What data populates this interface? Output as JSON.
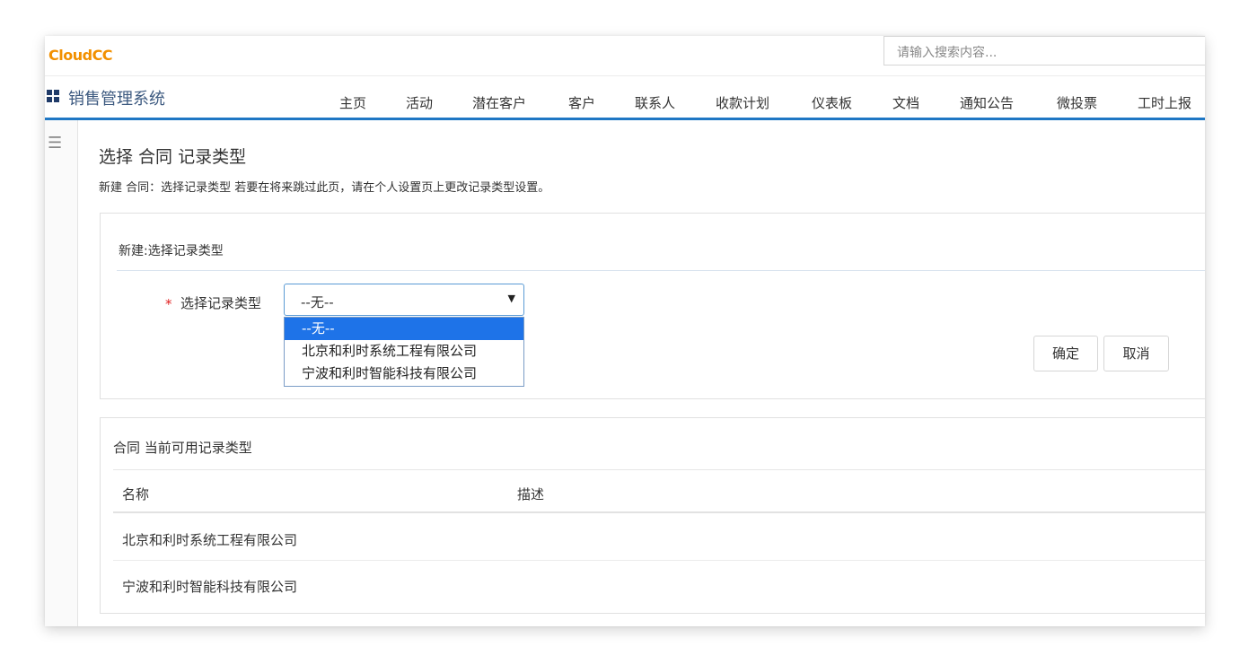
{
  "brand": {
    "logo": "CloudCC",
    "logo_color": "#f29000"
  },
  "search": {
    "placeholder": "请输入搜索内容..."
  },
  "app": {
    "title": "销售管理系统",
    "accent": "#1f77c4"
  },
  "nav": {
    "items": [
      "主页",
      "活动",
      "潜在客户",
      "客户",
      "联系人",
      "收款计划",
      "仪表板",
      "文档",
      "通知公告",
      "微投票",
      "工时上报"
    ]
  },
  "page": {
    "title": "选择 合同 记录类型",
    "subtitle": "新建 合同：选择记录类型 若要在将来跳过此页，请在个人设置页上更改记录类型设置。"
  },
  "form": {
    "panel_title": "新建:选择记录类型",
    "required_mark": "*",
    "field_label": "选择记录类型",
    "selected_value": "--无--",
    "options": [
      "--无--",
      "北京和利时系统工程有限公司",
      "宁波和利时智能科技有限公司"
    ],
    "ok_label": "确定",
    "cancel_label": "取消"
  },
  "available": {
    "title": "合同 当前可用记录类型",
    "columns": [
      "名称",
      "描述"
    ],
    "rows": [
      {
        "name": "北京和利时系统工程有限公司",
        "desc": ""
      },
      {
        "name": "宁波和利时智能科技有限公司",
        "desc": ""
      }
    ]
  }
}
